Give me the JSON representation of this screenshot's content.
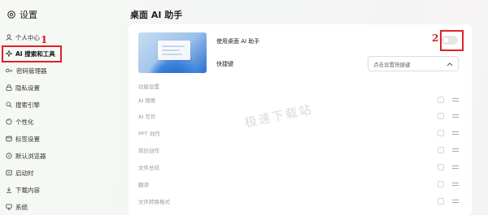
{
  "header": {
    "title": "设置"
  },
  "sidebar": {
    "items": [
      {
        "label": "个人中心"
      },
      {
        "label": "AI 搜索和工具",
        "active": true
      },
      {
        "label": "密码管理器"
      },
      {
        "label": "隐私设置"
      },
      {
        "label": "搜索引擎"
      },
      {
        "label": "个性化"
      },
      {
        "label": "标签设置"
      },
      {
        "label": "默认浏览器"
      },
      {
        "label": "启动时"
      },
      {
        "label": "下载内容"
      },
      {
        "label": "系统"
      }
    ]
  },
  "annotations": {
    "marker_1": "1",
    "marker_2": "2",
    "highlight_color": "#e0202a"
  },
  "main": {
    "title": "桌面 AI 助手",
    "enable_label": "使用桌面 AI 助手",
    "enable_toggle": false,
    "hotkey_label": "快捷键",
    "hotkey_placeholder": "点击设置快捷键",
    "section_title": "功能设置",
    "features": [
      {
        "label": "AI 搜索"
      },
      {
        "label": "AI 写作"
      },
      {
        "label": "PPT 创作"
      },
      {
        "label": "简历创作"
      },
      {
        "label": "文件总结"
      },
      {
        "label": "翻译"
      },
      {
        "label": "文件转换格式"
      }
    ]
  },
  "watermark": "极速下载站"
}
